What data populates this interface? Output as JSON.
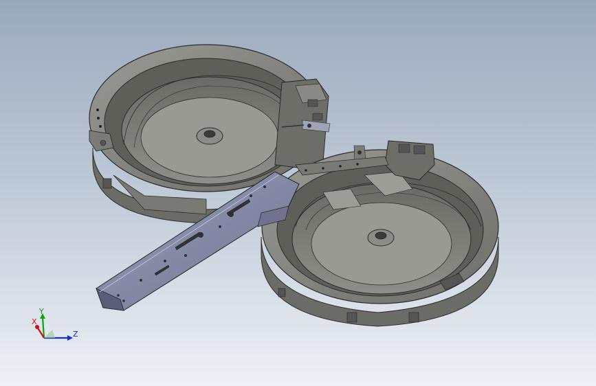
{
  "viewport": {
    "background_top": "#9aa9bc",
    "background_bottom": "#eef1f5"
  },
  "model": {
    "part_color": "#8a8a85",
    "plate_color": "#8a8fa8"
  },
  "triad": {
    "axis_x_label": "X",
    "axis_y_label": "Y",
    "axis_z_label": "Z",
    "axis_x_color": "#d01010",
    "axis_y_color": "#10a010",
    "axis_z_color": "#1030d0"
  }
}
